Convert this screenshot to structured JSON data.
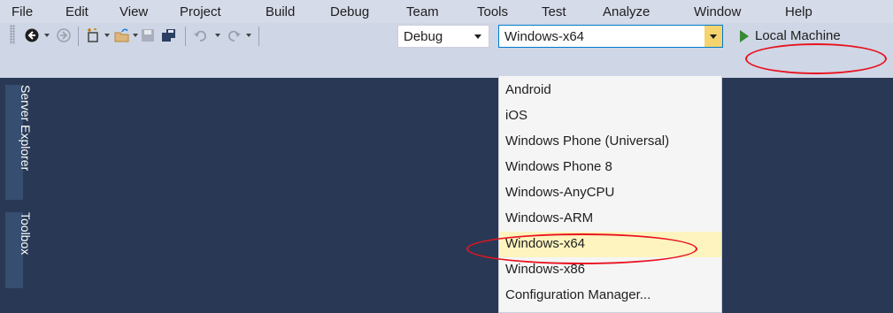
{
  "menu": [
    {
      "key": "file",
      "label": "File"
    },
    {
      "key": "edit",
      "label": "Edit"
    },
    {
      "key": "view",
      "label": "View"
    },
    {
      "key": "project",
      "label": "Project"
    },
    {
      "key": "build",
      "label": "Build"
    },
    {
      "key": "debug",
      "label": "Debug"
    },
    {
      "key": "team",
      "label": "Team"
    },
    {
      "key": "tools",
      "label": "Tools"
    },
    {
      "key": "test",
      "label": "Test"
    },
    {
      "key": "analyze",
      "label": "Analyze"
    },
    {
      "key": "window",
      "label": "Window"
    },
    {
      "key": "help",
      "label": "Help"
    }
  ],
  "toolbar": {
    "configuration": "Debug",
    "platform": "Windows-x64",
    "run_target": "Local Machine",
    "icons": [
      "back-arrow-icon",
      "forward-arrow-icon",
      "new-project-icon",
      "open-folder-icon",
      "save-icon",
      "save-all-icon",
      "undo-icon",
      "redo-icon"
    ]
  },
  "side_tabs": [
    "Server Explorer",
    "Toolbox"
  ],
  "platform_dropdown": {
    "items": [
      "Android",
      "iOS",
      "Windows Phone (Universal)",
      "Windows Phone 8",
      "Windows-AnyCPU",
      "Windows-ARM",
      "Windows-x64",
      "Windows-x86",
      "Configuration Manager..."
    ],
    "selected": "Windows-x64"
  },
  "colors": {
    "menubar_bg": "#d6dbe9",
    "toolbar_bg": "#cfd6e5",
    "editor_bg": "#293955",
    "dropdown_bg": "#f5f5f5",
    "selected_item_bg": "#fdf4bf",
    "accent_border": "#007acc",
    "annotation": "#e8131f",
    "play_green": "#388a34"
  }
}
